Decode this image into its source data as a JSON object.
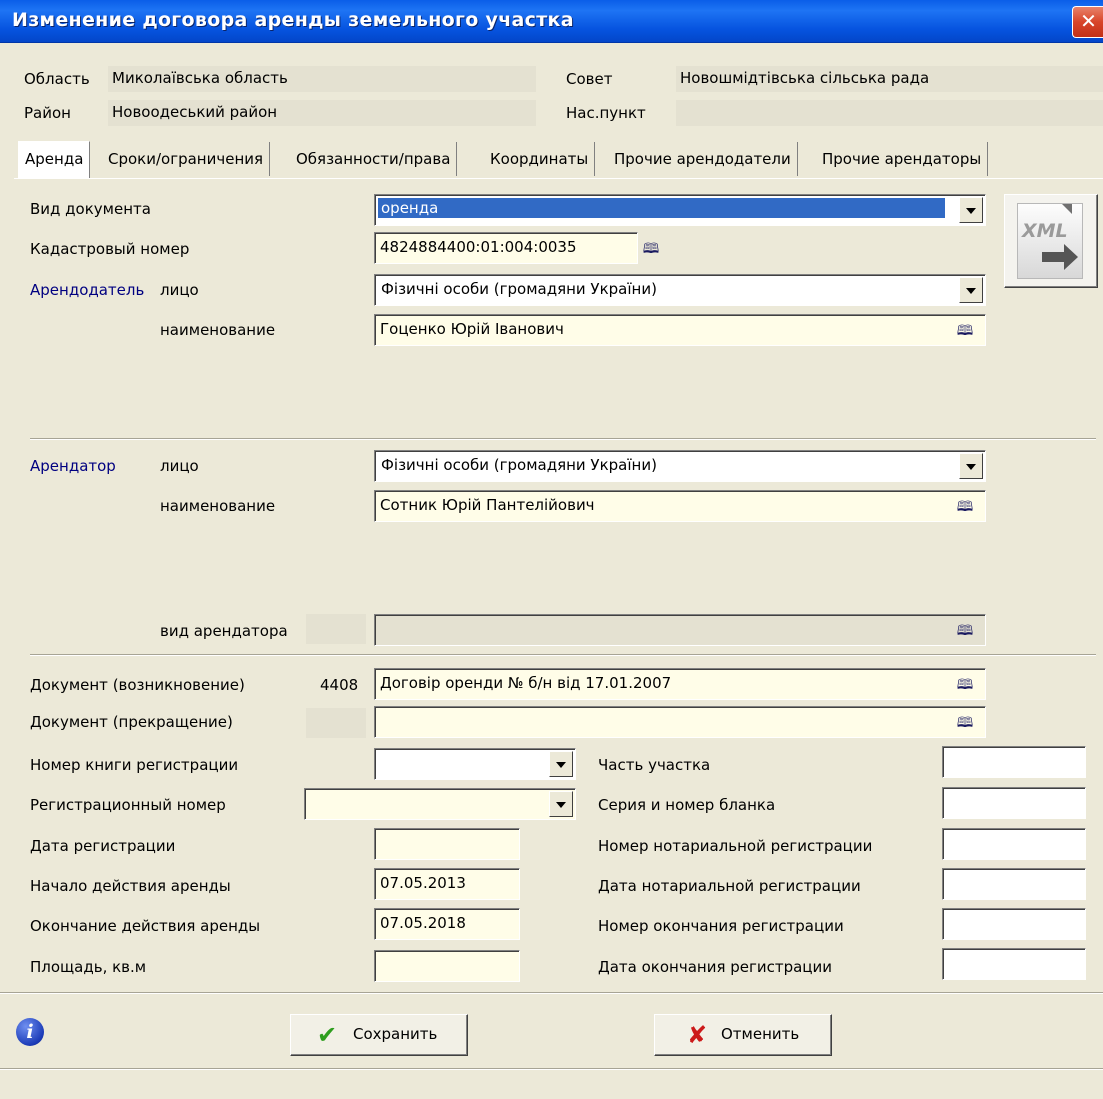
{
  "window": {
    "title": "Изменение договора аренды земельного участка"
  },
  "header": {
    "oblast_label": "Область",
    "oblast_value": "Миколаївська область",
    "rayon_label": "Район",
    "rayon_value": "Новоодеський район",
    "sovet_label": "Совет",
    "sovet_value": "Новошмідтівська сільська рада",
    "naspunkt_label": "Нас.пункт",
    "naspunkt_value": ""
  },
  "tabs": [
    {
      "label": "Аренда",
      "active": true
    },
    {
      "label": "Сроки/ограничения"
    },
    {
      "label": "Обязанности/права"
    },
    {
      "label": "Координаты"
    },
    {
      "label": "Прочие арендодатели"
    },
    {
      "label": "Прочие арендаторы"
    }
  ],
  "lease": {
    "doc_type_label": "Вид документа",
    "doc_type_value": "оренда",
    "cadastral_label": "Кадастровый номер",
    "cadastral_value": "4824884400:01:004:0035",
    "lessor_label": "Арендодатель",
    "lessor_person_label": "лицо",
    "lessor_person_value": "Фізичні особи (громадяни України)",
    "lessor_name_label": "наименование",
    "lessor_name_value": "Гоценко Юрій Іванович",
    "lessee_label": "Арендатор",
    "lessee_person_label": "лицо",
    "lessee_person_value": "Фізичні особи (громадяни України)",
    "lessee_name_label": "наименование",
    "lessee_name_value": "Сотник Юрій Пантелійович",
    "lessee_kind_label": "вид арендатора",
    "lessee_kind_code": "",
    "lessee_kind_value": "",
    "doc_start_label": "Документ (возникновение)",
    "doc_start_code": "4408",
    "doc_start_value": "Договір оренди № б/н від 17.01.2007",
    "doc_end_label": "Документ (прекращение)",
    "doc_end_code": "",
    "doc_end_value": "",
    "regbook_label": "Номер книги регистрации",
    "regbook_value": "",
    "regnum_label": "Регистрационный номер",
    "regnum_value": "",
    "regdate_label": "Дата регистрации",
    "regdate_value": "",
    "lease_start_label": "Начало действия аренды",
    "lease_start_value": "07.05.2013",
    "lease_end_label": "Окончание действия аренды",
    "lease_end_value": "07.05.2018",
    "area_label": "Площадь, кв.м",
    "area_value": "",
    "part_label": "Часть участка",
    "part_value": "",
    "blank_label": "Серия и номер бланка",
    "blank_value": "",
    "notary_num_label": "Номер нотариальной регистрации",
    "notary_num_value": "",
    "notary_date_label": "Дата нотариальной регистрации",
    "notary_date_value": "",
    "end_reg_num_label": "Номер окончания регистрации",
    "end_reg_num_value": "",
    "end_reg_date_label": "Дата окончания регистрации",
    "end_reg_date_value": ""
  },
  "xml_button": {
    "label": "XML"
  },
  "footer": {
    "save_label": "Сохранить",
    "cancel_label": "Отменить"
  },
  "icons": {
    "info": "info-icon",
    "lookup": "book-icon",
    "save": "checkmark-icon",
    "cancel": "cross-icon"
  }
}
